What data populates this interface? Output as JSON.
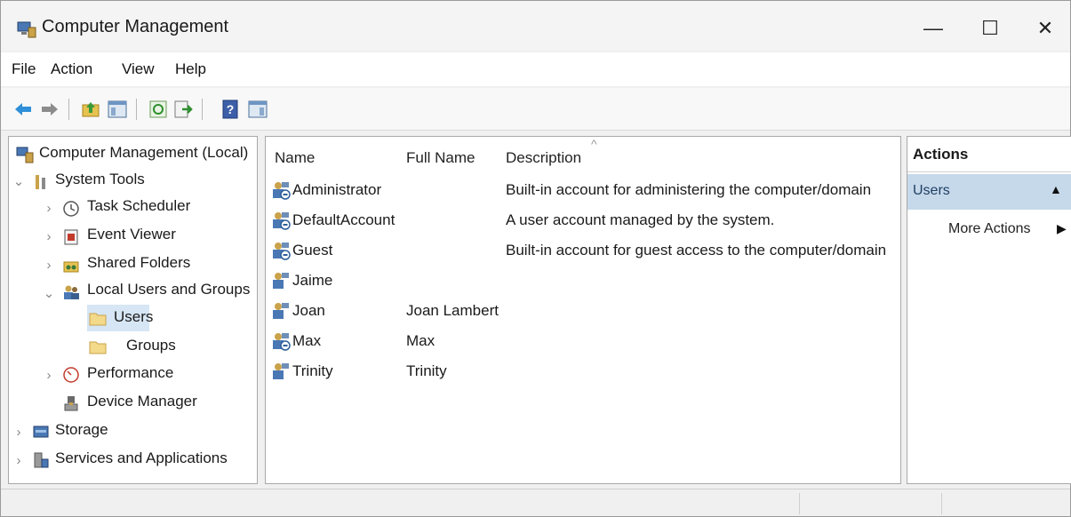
{
  "window": {
    "title": "Computer Management",
    "controls": {
      "minimize": "—",
      "maximize": "☐",
      "close": "✕"
    }
  },
  "menu": [
    "File",
    "Action",
    "View",
    "Help"
  ],
  "toolbar": {
    "icons": [
      "back-arrow-icon",
      "forward-arrow-icon",
      "up-folder-icon",
      "show-hide-tree-icon",
      "refresh-icon",
      "export-list-icon",
      "help-icon",
      "show-hide-action-pane-icon"
    ]
  },
  "tree": {
    "root": "Computer Management (Local)",
    "system_tools": "System Tools",
    "task_scheduler": "Task Scheduler",
    "event_viewer": "Event Viewer",
    "shared_folders": "Shared Folders",
    "local_users_groups": "Local Users and Groups",
    "users": "Users",
    "groups": "Groups",
    "performance": "Performance",
    "device_manager": "Device Manager",
    "storage": "Storage",
    "services_apps": "Services and Applications"
  },
  "list": {
    "columns": {
      "name": "Name",
      "full_name": "Full Name",
      "description": "Description"
    },
    "rows": [
      {
        "name": "Administrator",
        "full_name": "",
        "description": "Built-in account for administering the computer/domain",
        "disabled": true
      },
      {
        "name": "DefaultAccount",
        "full_name": "",
        "description": "A user account managed by the system.",
        "disabled": true
      },
      {
        "name": "Guest",
        "full_name": "",
        "description": "Built-in account for guest access to the computer/domain",
        "disabled": true
      },
      {
        "name": "Jaime",
        "full_name": "",
        "description": "",
        "disabled": false
      },
      {
        "name": "Joan",
        "full_name": "Joan Lambert",
        "description": "",
        "disabled": false
      },
      {
        "name": "Max",
        "full_name": "Max",
        "description": "",
        "disabled": true
      },
      {
        "name": "Trinity",
        "full_name": "Trinity",
        "description": "",
        "disabled": false
      }
    ]
  },
  "actions": {
    "header": "Actions",
    "section": "Users",
    "more": "More Actions"
  },
  "colors": {
    "selection": "#d6e6f4",
    "actions_section": "#c6d9ea",
    "folder": "#f3d98a"
  }
}
